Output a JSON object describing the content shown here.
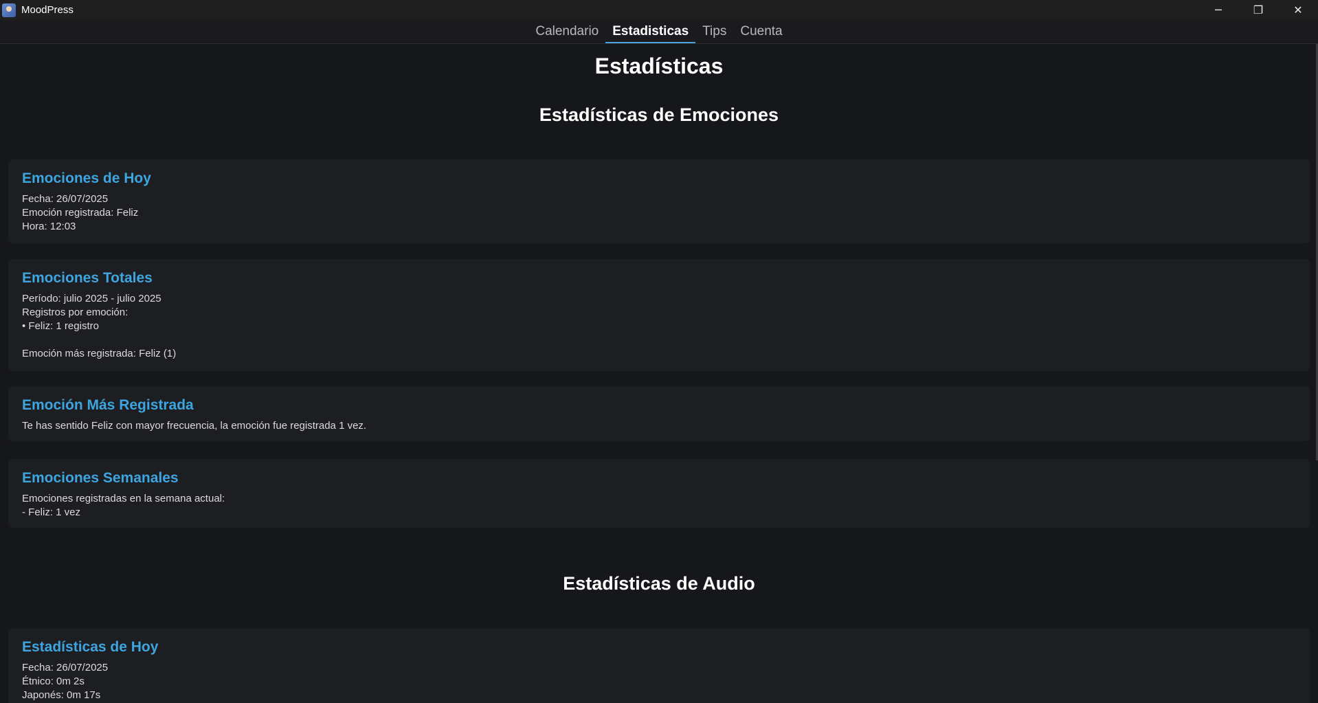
{
  "window": {
    "title": "MoodPress",
    "minimize_glyph": "─",
    "maximize_glyph": "❐",
    "close_glyph": "✕"
  },
  "tabs": [
    {
      "label": "Calendario",
      "active": false
    },
    {
      "label": "Estadisticas",
      "active": true
    },
    {
      "label": "Tips",
      "active": false
    },
    {
      "label": "Cuenta",
      "active": false
    }
  ],
  "page": {
    "title": "Estadísticas"
  },
  "emotions_section": {
    "title": "Estadísticas de Emociones",
    "cards": [
      {
        "title": "Emociones de Hoy",
        "lines": [
          "Fecha: 26/07/2025",
          "Emoción registrada: Feliz",
          "Hora: 12:03"
        ]
      },
      {
        "title": "Emociones Totales",
        "lines": [
          "Período: julio 2025 - julio 2025",
          "Registros por emoción:",
          "• Feliz: 1 registro",
          "",
          "Emoción más registrada: Feliz (1)"
        ]
      },
      {
        "title": "Emoción Más Registrada",
        "lines": [
          "Te has sentido Feliz con mayor frecuencia, la emoción fue registrada 1 vez."
        ]
      },
      {
        "title": "Emociones Semanales",
        "lines": [
          "Emociones registradas en la semana actual:",
          "- Feliz: 1 vez"
        ]
      }
    ]
  },
  "audio_section": {
    "title": "Estadísticas de Audio",
    "cards": [
      {
        "title": "Estadísticas de Hoy",
        "lines": [
          "Fecha: 26/07/2025",
          "Étnico: 0m 2s",
          "Japonés: 0m 17s"
        ]
      }
    ]
  },
  "colors": {
    "accent": "#3da5e0",
    "background": "#16171b",
    "card": "#1d1e22"
  }
}
